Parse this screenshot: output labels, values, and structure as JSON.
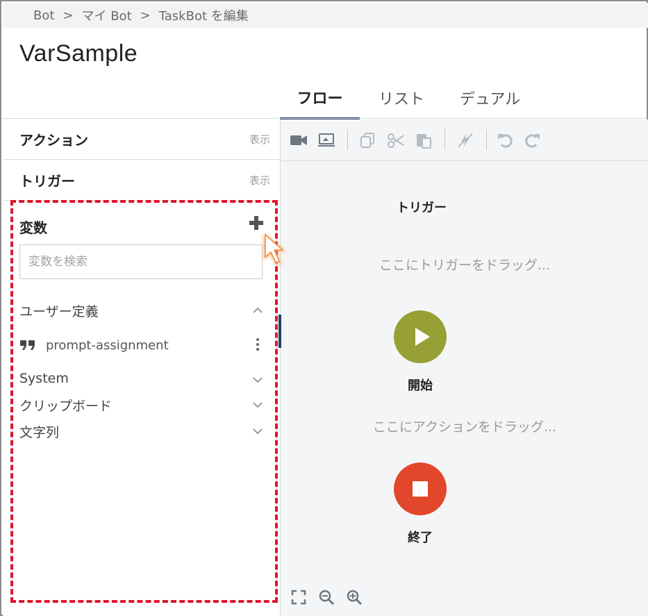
{
  "breadcrumb": {
    "item1": "Bot",
    "item2": "マイ Bot",
    "item3": "TaskBot を編集",
    "separator": ">"
  },
  "page_title": "VarSample",
  "tabs": [
    {
      "label": "フロー",
      "active": true
    },
    {
      "label": "リスト"
    },
    {
      "label": "デュアル"
    }
  ],
  "left_panel": {
    "actions": {
      "title": "アクション",
      "link": "表示"
    },
    "triggers": {
      "title": "トリガー",
      "link": "表示"
    },
    "variables": {
      "title": "変数",
      "search_placeholder": "変数を検索",
      "groups": [
        {
          "label": "ユーザー定義",
          "expanded": true,
          "items": [
            {
              "name": "prompt-assignment",
              "icon": "quote-icon"
            }
          ]
        },
        {
          "label": "System",
          "expanded": false
        },
        {
          "label": "クリップボード",
          "expanded": false
        },
        {
          "label": "文字列",
          "expanded": false
        }
      ]
    }
  },
  "canvas": {
    "trigger_label": "トリガー",
    "trigger_drop": "ここにトリガーをドラッグ...",
    "start_label": "開始",
    "action_drop": "ここにアクションをドラッグ...",
    "end_label": "終了"
  },
  "toolbar_icons": [
    "record-icon",
    "screen-capture-icon",
    "copy-icon",
    "cut-icon",
    "paste-icon",
    "disable-icon",
    "undo-icon",
    "redo-icon"
  ],
  "zoom_icons": [
    "fit-screen-icon",
    "zoom-out-icon",
    "zoom-in-icon"
  ],
  "colors": {
    "start": "#97a034",
    "end": "#e2462b",
    "highlight": "#e0162b",
    "tab_underline": "#2a3f6a"
  }
}
